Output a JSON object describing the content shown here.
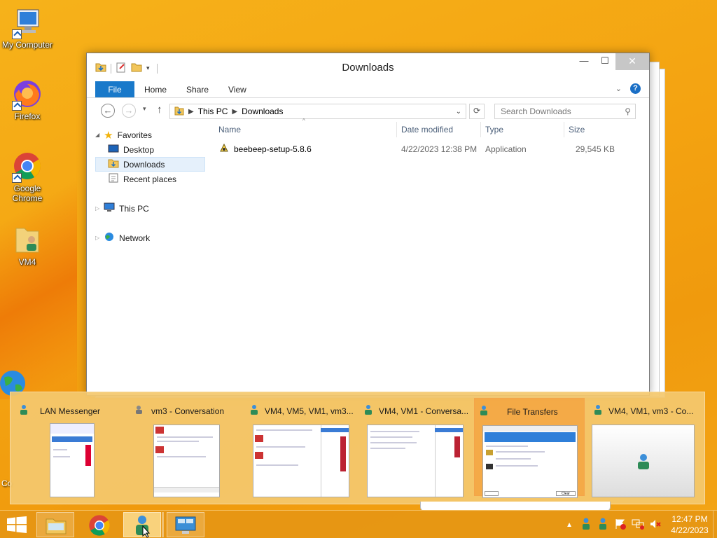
{
  "desktop": {
    "icons": [
      {
        "label": "My Computer",
        "icon": "computer-icon"
      },
      {
        "label": "Firefox",
        "icon": "firefox-icon"
      },
      {
        "label": "Google Chrome",
        "icon": "chrome-icon"
      },
      {
        "label": "VM4",
        "icon": "folder-user-icon"
      },
      {
        "label": "Co",
        "icon": "globe-icon"
      }
    ]
  },
  "explorer": {
    "title": "Downloads",
    "ribbon": {
      "file": "File",
      "tabs": [
        "Home",
        "Share",
        "View"
      ]
    },
    "breadcrumb": [
      "This PC",
      "Downloads"
    ],
    "search_placeholder": "Search Downloads",
    "nav": {
      "favorites": "Favorites",
      "favorites_items": [
        "Desktop",
        "Downloads",
        "Recent places"
      ],
      "this_pc": "This PC",
      "network": "Network",
      "selected": "Downloads"
    },
    "columns": [
      "Name",
      "Date modified",
      "Type",
      "Size"
    ],
    "files": [
      {
        "name": "beebeep-setup-5.8.6",
        "date": "4/22/2023 12:38 PM",
        "type": "Application",
        "size": "29,545 KB"
      }
    ]
  },
  "thumbnails": [
    {
      "title": "LAN Messenger"
    },
    {
      "title": "vm3 - Conversation"
    },
    {
      "title": "VM4, VM5, VM1, vm3..."
    },
    {
      "title": "VM4, VM1 - Conversa..."
    },
    {
      "title": "File Transfers"
    },
    {
      "title": "VM4, VM1, vm3 - Co..."
    }
  ],
  "thumb_contents": {
    "file_transfers_footer": "Clear"
  },
  "taskbar": {
    "clock_time": "12:47 PM",
    "clock_date": "4/22/2023"
  },
  "colors": {
    "accent": "#1979ca",
    "desktop": "#f4a311",
    "highlight": "#f4a03c"
  }
}
